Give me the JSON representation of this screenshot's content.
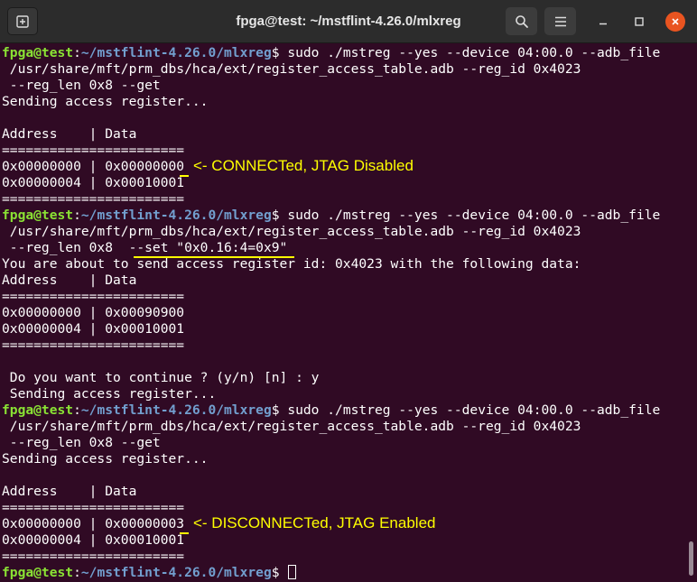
{
  "window": {
    "title": "fpga@test: ~/mstflint-4.26.0/mlxreg"
  },
  "icons": {
    "new_tab": "new-tab-icon",
    "search": "search-icon",
    "menu": "hamburger-menu-icon",
    "minimize": "minimize-icon",
    "maximize": "maximize-icon",
    "close": "close-icon"
  },
  "colors": {
    "background": "#300a24",
    "prompt_user": "#8ae234",
    "prompt_path": "#729fcf",
    "annotation": "#ffff00",
    "close_button": "#e95420"
  },
  "prompt": {
    "user": "fpga@test",
    "sep": ":",
    "path": "~/mstflint-4.26.0/mlxreg",
    "sym": "$ "
  },
  "terminal": {
    "cmd1": "sudo ./mstreg --yes --device 04:00.0 --adb_file",
    "l2": " /usr/share/mft/prm_dbs/hca/ext/register_access_table.adb --reg_id 0x4023",
    "l3": " --reg_len 0x8 --get",
    "l4": "Sending access register...",
    "l5": "",
    "l6": "Address    | Data",
    "l7": "=======================",
    "l8": "0x00000000 | 0x00000000",
    "l9": "0x00000004 | 0x00010001",
    "l10": "=======================",
    "cmd11": "sudo ./mstreg --yes --device 04:00.0 --adb_file",
    "l12": " /usr/share/mft/prm_dbs/hca/ext/register_access_table.adb --reg_id 0x4023",
    "l13": " --reg_len 0x8  --set \"0x0.16:4=0x9\"",
    "l14": "You are about to send access register id: 0x4023 with the following data:",
    "l15": "Address    | Data",
    "l16": "=======================",
    "l17": "0x00000000 | 0x00090900",
    "l18": "0x00000004 | 0x00010001",
    "l19": "=======================",
    "l20": "",
    "l21": " Do you want to continue ? (y/n) [n] : y",
    "l22": " Sending access register...",
    "cmd23": "sudo ./mstreg --yes --device 04:00.0 --adb_file",
    "l24": " /usr/share/mft/prm_dbs/hca/ext/register_access_table.adb --reg_id 0x4023",
    "l25": " --reg_len 0x8 --get",
    "l26": "Sending access register...",
    "l27": "",
    "l28": "Address    | Data",
    "l29": "=======================",
    "l30": "0x00000000 | 0x00000003",
    "l31": "0x00000004 | 0x00010001",
    "l32": "=======================",
    "cmd33": ""
  },
  "annotations": {
    "a1": "<- CONNECTed, JTAG Disabled",
    "a2": "<- DISCONNECTed, JTAG Enabled"
  }
}
